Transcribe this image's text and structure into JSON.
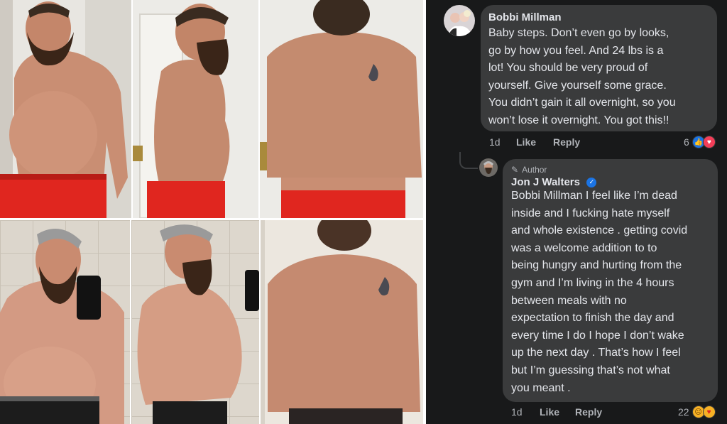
{
  "collage": {
    "photos": [
      {
        "desc": "before-front"
      },
      {
        "desc": "before-side"
      },
      {
        "desc": "before-back"
      },
      {
        "desc": "after-front-mirror"
      },
      {
        "desc": "after-side-mirror"
      },
      {
        "desc": "after-back"
      }
    ]
  },
  "comments": [
    {
      "author": "Bobbi Millman",
      "lines": [
        "Baby steps.   Don’t even go by looks,",
        "go by how you feel.   And 24 lbs is a",
        "lot!  You should be very proud of",
        "yourself.   Give yourself some grace.",
        "You didn’t gain it all overnight, so you",
        "won’t lose it overnight.   You got this!!"
      ],
      "time": "1d",
      "like_label": "Like",
      "reply_label": "Reply",
      "reaction_count": "6",
      "reactions": [
        "like",
        "love"
      ]
    },
    {
      "badge": "Author",
      "author": "Jon J Walters",
      "verified": true,
      "lines": [
        "Bobbi Millman  I feel like I’m dead",
        "inside and I fucking hate myself",
        "and whole existence . getting covid",
        "was a welcome addition to to",
        "being hungry and hurting from the",
        "gym and I’m living in the 4 hours",
        "between meals with no",
        "expectation to finish the day and",
        "every time I do I hope I don’t wake",
        "up the next day .   That’s how I feel",
        "but I’m guessing that’s not what",
        "you meant ."
      ],
      "time": "1d",
      "like_label": "Like",
      "reply_label": "Reply",
      "reaction_count": "22",
      "reactions": [
        "sad",
        "care"
      ]
    }
  ],
  "colors": {
    "panel_bg": "#18191a",
    "bubble_bg": "#3a3b3c",
    "text": "#e4e6eb",
    "muted": "#b0b3b8",
    "like_blue": "#1b74e4",
    "love_red": "#f33e58",
    "shorts_red": "#e0261f"
  }
}
